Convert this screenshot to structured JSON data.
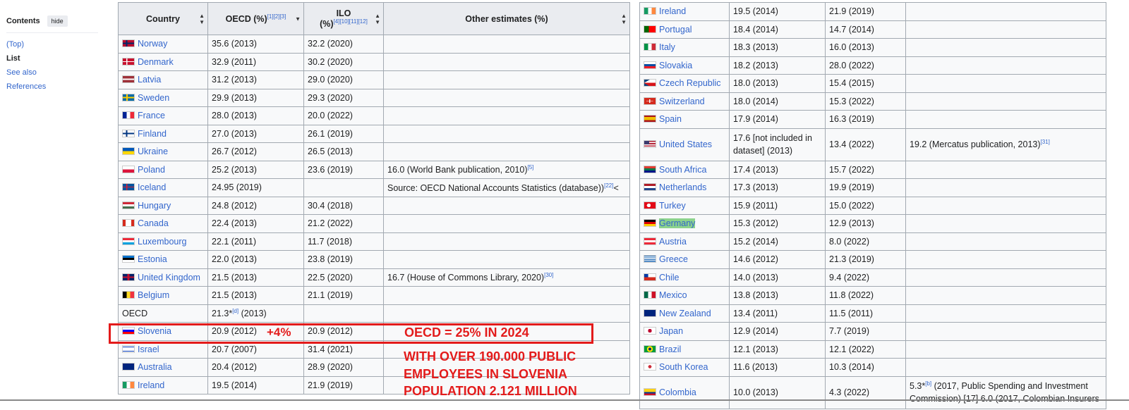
{
  "toc": {
    "title": "Contents",
    "hide_label": "hide",
    "items": [
      {
        "label": "(Top)",
        "current": false
      },
      {
        "label": "List",
        "current": true
      },
      {
        "label": "See also",
        "current": false
      },
      {
        "label": "References",
        "current": false
      }
    ]
  },
  "table_headers": {
    "country": "Country",
    "oecd": "OECD (%)",
    "oecd_refs": "[1][2][3]",
    "ilo": "ILO",
    "ilo_sub": "(%)",
    "ilo_refs": "[4][10][11][12]",
    "other": "Other estimates (%)"
  },
  "rows_left": [
    {
      "country": "Norway",
      "flag": "norway-flag",
      "oecd": "35.6 (2013)",
      "ilo": "32.2 (2020)",
      "other": ""
    },
    {
      "country": "Denmark",
      "flag": "denmark-flag",
      "oecd": "32.9 (2011)",
      "ilo": "30.2 (2020)",
      "other": ""
    },
    {
      "country": "Latvia",
      "flag": "latvia-flag",
      "oecd": "31.2 (2013)",
      "ilo": "29.0 (2020)",
      "other": ""
    },
    {
      "country": "Sweden",
      "flag": "sweden-flag",
      "oecd": "29.9 (2013)",
      "ilo": "29.3 (2020)",
      "other": ""
    },
    {
      "country": "France",
      "flag": "france-flag",
      "oecd": "28.0 (2013)",
      "ilo": "20.0 (2022)",
      "other": ""
    },
    {
      "country": "Finland",
      "flag": "finland-flag",
      "oecd": "27.0 (2013)",
      "ilo": "26.1 (2019)",
      "other": ""
    },
    {
      "country": "Ukraine",
      "flag": "ukraine-flag",
      "oecd": "26.7 (2012)",
      "ilo": "26.5 (2013)",
      "other": ""
    },
    {
      "country": "Poland",
      "flag": "poland-flag",
      "oecd": "25.2 (2013)",
      "ilo": "23.6 (2019)",
      "other": "16.0 (World Bank publication, 2010)",
      "other_ref": "[5]"
    },
    {
      "country": "Iceland",
      "flag": "iceland-flag",
      "oecd": "24.95 (2019)",
      "ilo": "",
      "other": "Source: OECD National Accounts Statistics (database))",
      "other_ref": "[22]",
      "other_tail": "<"
    },
    {
      "country": "Hungary",
      "flag": "hungary-flag",
      "oecd": "24.8 (2012)",
      "ilo": "30.4 (2018)",
      "other": ""
    },
    {
      "country": "Canada",
      "flag": "canada-flag",
      "oecd": "22.4 (2013)",
      "ilo": "21.2 (2022)",
      "other": ""
    },
    {
      "country": "Luxembourg",
      "flag": "luxembourg-flag",
      "oecd": "22.1 (2011)",
      "ilo": "11.7 (2018)",
      "other": ""
    },
    {
      "country": "Estonia",
      "flag": "estonia-flag",
      "oecd": "22.0 (2013)",
      "ilo": "23.8 (2019)",
      "other": ""
    },
    {
      "country": "United Kingdom",
      "flag": "uk-flag",
      "oecd": "21.5 (2013)",
      "ilo": "22.5 (2020)",
      "other": "16.7 (House of Commons Library, 2020)",
      "other_ref": "[30]"
    },
    {
      "country": "Belgium",
      "flag": "belgium-flag",
      "oecd": "21.5 (2013)",
      "ilo": "21.1 (2019)",
      "other": ""
    },
    {
      "country": "OECD",
      "flag": "",
      "oecd": "21.3*",
      "oecd_ref": "[d]",
      "oecd_tail": " (2013)",
      "ilo": "",
      "other": "",
      "plain": true
    },
    {
      "country": "Slovenia",
      "flag": "slovenia-flag",
      "oecd": "20.9 (2012)",
      "ilo": "20.9 (2012)",
      "other": ""
    },
    {
      "country": "Israel",
      "flag": "israel-flag",
      "oecd": "20.7 (2007)",
      "ilo": "31.4 (2021)",
      "other": ""
    },
    {
      "country": "Australia",
      "flag": "australia-flag",
      "oecd": "20.4 (2012)",
      "ilo": "28.9 (2020)",
      "other": ""
    },
    {
      "country": "Ireland",
      "flag": "ireland-flag",
      "oecd": "19.5 (2014)",
      "ilo": "21.9 (2019)",
      "other": ""
    }
  ],
  "rows_right": [
    {
      "country": "Ireland",
      "flag": "ireland-flag",
      "oecd": "19.5 (2014)",
      "ilo": "21.9 (2019)",
      "other": ""
    },
    {
      "country": "Portugal",
      "flag": "portugal-flag",
      "oecd": "18.4 (2014)",
      "ilo": "14.7 (2014)",
      "other": ""
    },
    {
      "country": "Italy",
      "flag": "italy-flag",
      "oecd": "18.3 (2013)",
      "ilo": "16.0 (2013)",
      "other": ""
    },
    {
      "country": "Slovakia",
      "flag": "slovakia-flag",
      "oecd": "18.2 (2013)",
      "ilo": "28.0 (2022)",
      "other": ""
    },
    {
      "country": "Czech Republic",
      "flag": "czech-flag",
      "oecd": "18.0 (2013)",
      "ilo": "15.4 (2015)",
      "other": ""
    },
    {
      "country": "Switzerland",
      "flag": "switzerland-flag",
      "oecd": "18.0 (2014)",
      "ilo": "15.3 (2022)",
      "other": ""
    },
    {
      "country": "Spain",
      "flag": "spain-flag",
      "oecd": "17.9 (2014)",
      "ilo": "16.3 (2019)",
      "other": ""
    },
    {
      "country": "United States",
      "flag": "us-flag",
      "oecd": "17.6 [not included in dataset] (2013)",
      "ilo": "13.4 (2022)",
      "other": "19.2 (Mercatus publication, 2013)",
      "other_ref": "[31]",
      "tall": true
    },
    {
      "country": "South Africa",
      "flag": "south-africa-flag",
      "oecd": "17.4 (2013)",
      "ilo": "15.7 (2022)",
      "other": ""
    },
    {
      "country": "Netherlands",
      "flag": "netherlands-flag",
      "oecd": "17.3 (2013)",
      "ilo": "19.9 (2019)",
      "other": ""
    },
    {
      "country": "Turkey",
      "flag": "turkey-flag",
      "oecd": "15.9 (2011)",
      "ilo": "15.0 (2022)",
      "other": ""
    },
    {
      "country": "Germany",
      "flag": "germany-flag",
      "oecd": "15.3 (2012)",
      "ilo": "12.9 (2013)",
      "other": "",
      "highlight": true
    },
    {
      "country": "Austria",
      "flag": "austria-flag",
      "oecd": "15.2 (2014)",
      "ilo": "8.0 (2022)",
      "other": ""
    },
    {
      "country": "Greece",
      "flag": "greece-flag",
      "oecd": "14.6 (2012)",
      "ilo": "21.3 (2019)",
      "other": ""
    },
    {
      "country": "Chile",
      "flag": "chile-flag",
      "oecd": "14.0 (2013)",
      "ilo": "9.4 (2022)",
      "other": ""
    },
    {
      "country": "Mexico",
      "flag": "mexico-flag",
      "oecd": "13.8 (2013)",
      "ilo": "11.8 (2022)",
      "other": ""
    },
    {
      "country": "New Zealand",
      "flag": "new-zealand-flag",
      "oecd": "13.4 (2011)",
      "ilo": "11.5 (2011)",
      "other": ""
    },
    {
      "country": "Japan",
      "flag": "japan-flag",
      "oecd": "12.9 (2014)",
      "ilo": "7.7 (2019)",
      "other": ""
    },
    {
      "country": "Brazil",
      "flag": "brazil-flag",
      "oecd": "12.1 (2013)",
      "ilo": "12.1 (2022)",
      "other": ""
    },
    {
      "country": "South Korea",
      "flag": "south-korea-flag",
      "oecd": "11.6 (2013)",
      "ilo": "10.3 (2014)",
      "other": ""
    },
    {
      "country": "Colombia",
      "flag": "colombia-flag",
      "oecd": "10.0 (2013)",
      "ilo": "4.3 (2022)",
      "other": "5.3*",
      "other_ref": "[b]",
      "other_tail": " (2017, Public Spending and Investment Commission) [17] 6.0 (2017, Colombian Insurers",
      "tall": true
    }
  ],
  "annotations": {
    "plus": "+4%",
    "oecd_2024": "OECD = 25% IN 2024",
    "employees_lines": [
      "WITH OVER 190.000 PUBLIC",
      "EMPLOYEES IN SLOVENIA",
      "POPULATION 2.121 MILLION"
    ],
    "color": "#e31b1b"
  }
}
